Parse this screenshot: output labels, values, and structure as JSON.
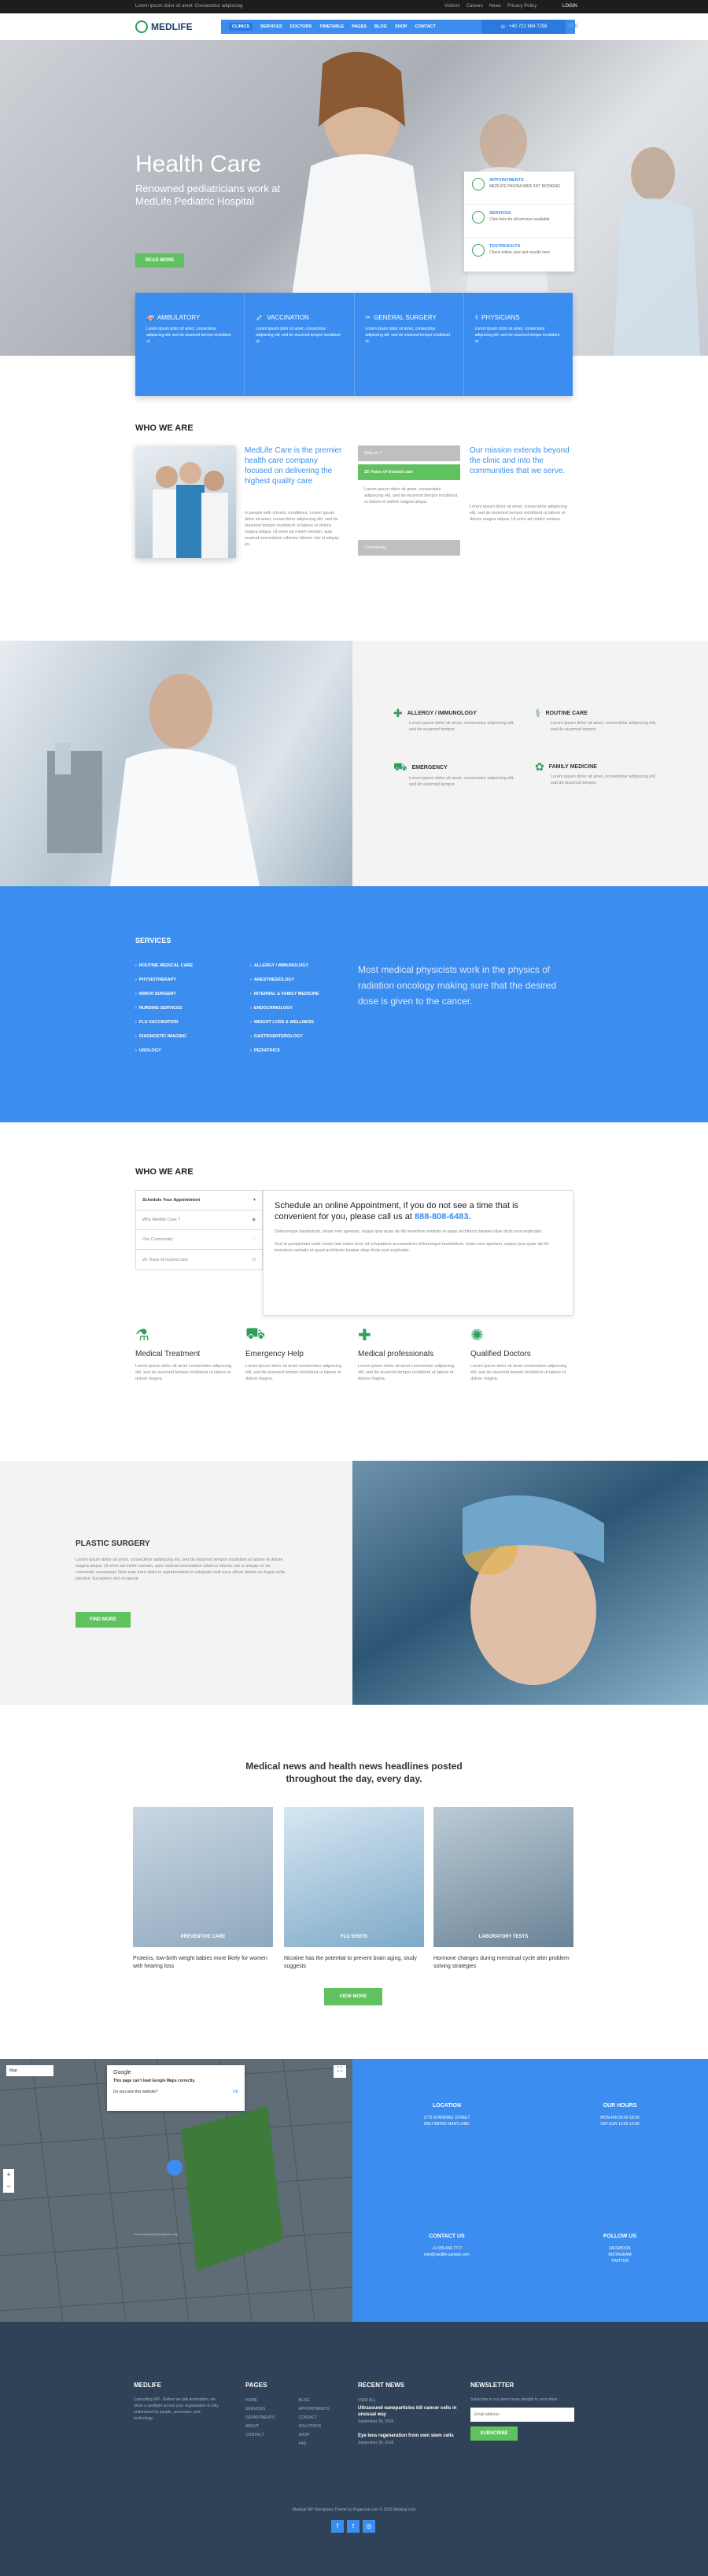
{
  "topbar": {
    "left": "Lorem ipsum dolor sit amet: Consectetur adipiscing",
    "links": [
      "Visitors",
      "Careers",
      "News",
      "Privacy Policy"
    ],
    "login": "LOGIN"
  },
  "header": {
    "logo": "MEDLIFE",
    "nav": [
      "CLINICS",
      "SERVICES",
      "DOCTORS",
      "TIMETABLE",
      "PAGES",
      "BLOG",
      "SHOP",
      "CONTACT"
    ],
    "phone": "+40 722 884 7256",
    "cart": "0"
  },
  "hero": {
    "title": "Health Care",
    "subtitle": "Renowned pediatricians work at MedLife Pediatric Hospital",
    "button": "READ MORE"
  },
  "side_card": [
    {
      "title": "APPOINTMENTS",
      "text": "MEDLIFE PAGINA WEB 24/7 BOOKING"
    },
    {
      "title": "SERVICES",
      "text": "Click here for all services available"
    },
    {
      "title": "TESTRESULTS",
      "text": "Check online your test results here"
    }
  ],
  "features": [
    {
      "title": "AMBULATORY",
      "text": "Lorem ipsum dolor sit amet, consectetur adipiscing elit, sed do eiusmod tempor incididunt ut."
    },
    {
      "title": "VACCINATION",
      "text": "Lorem ipsum dolor sit amet, consectetur adipiscing elit, sed do eiusmod tempor incididunt ut."
    },
    {
      "title": "GENERAL SURGERY",
      "text": "Lorem ipsum dolor sit amet, consectetur adipiscing elit, sed do eiusmod tempor incididunt ut."
    },
    {
      "title": "PHYSICIANS",
      "text": "Lorem ipsum dolor sit amet, consectetur adipiscing elit, sed do eiusmod tempor incididunt ut."
    }
  ],
  "who": {
    "heading": "WHO WE ARE",
    "lead": "MedLife Care is the premier health care company focused on delivering the highest quality care",
    "body": "In people with chronic conditions, Lorem ipsum dolor sit amet, consectetur adipiscing elit, sed do eiusmod tempor incididunt ut labore et dolore magna aliqua. Ut enim ad minim veniam, quis nostrud exercitation ullamco laboris nisi ut aliquip ex.",
    "tabs": [
      "Why us ?",
      "25 Years of trusted care",
      "Community"
    ],
    "tab_text": "Lorem ipsum dolor sit amet, consectetur adipiscing elit, sed do eiusmod tempor incididunt ut labore et dolore magna aliqua.",
    "mission": "Our mission extends beyond the clinic and into the communities that we serve.",
    "mission_text": "Lorem ipsum dolor sit amet, consectetur adipiscing elit, sed do eiusmod tempor incididunt ut labore et dolore magna aliqua. Ut enim ad minim veniam."
  },
  "lab": [
    {
      "title": "ALLERGY / IMMUNOLOGY",
      "text": "Lorem ipsum dolor sit amet, consectetur adipiscing elit, sed do eiusmod tempor."
    },
    {
      "title": "ROUTINE CARE",
      "text": "Lorem ipsum dolor sit amet, consectetur adipiscing elit, sed do eiusmod tempor."
    },
    {
      "title": "EMERGENCY",
      "text": "Lorem ipsum dolor sit amet, consectetur adipiscing elit, sed do eiusmod tempor."
    },
    {
      "title": "FAMILY MEDICINE",
      "text": "Lorem ipsum dolor sit amet, consectetur adipiscing elit, sed do eiusmod tempor."
    }
  ],
  "services": {
    "heading": "SERVICES",
    "col1": [
      "ROUTINE MEDICAL CARE",
      "PHYSIOTHERAPY",
      "MINOR SURGERY",
      "NURSING SERVICES",
      "FLU VACCINATION",
      "DIAGNOSTIC IMAGING",
      "UROLOGY"
    ],
    "col2": [
      "ALLERGY / IMMUNOLOGY",
      "ANESTHESIOLOGY",
      "INTERNAL & FAMILY MEDICINE",
      "ENDOCRINOLOGY",
      "WEIGHT LOSS & WELLNESS",
      "GASTROENTEROLOGY",
      "PEDIATRICS"
    ],
    "quote": "Most medical physicists work in the physics of radiation oncology making sure that the desired dose is given to the cancer."
  },
  "who2": {
    "heading": "WHO WE ARE",
    "accordion": [
      "Schedule Your Appointment",
      "Why Medlife Care ?",
      "Our Community",
      "25 Years of trusted care"
    ],
    "appt_title": "Schedule an online Appointment, if you do not see a time that is convenient for you, please call us at",
    "appt_phone": "888-808-6483.",
    "appt_text1": "Doloremque laudantium, totam rem aperiam, eaque ipsa quae ab illo inventore veritatis et quasi architecto beatae vitae dicta sunt explicabo.",
    "appt_text2": "Sed ut perspiciatis unde omnis iste natus error sit voluptatem accusantium doloremque laudantium, totam rem aperiam, eaque ipsa quae ab illo inventore veritatis et quasi architecto beatae vitae dicta sunt explicabo.",
    "items": [
      {
        "title": "Medical Treatment",
        "text": "Lorem ipsum dolor sit amet consectetur adipiscing elit, sed do eiusmod tempor incididunt ut labore et dolore magna."
      },
      {
        "title": "Emergency Help",
        "text": "Lorem ipsum dolor sit amet consectetur adipiscing elit, sed do eiusmod tempor incididunt ut labore et dolore magna."
      },
      {
        "title": "Medical professionals",
        "text": "Lorem ipsum dolor sit amet consectetur adipiscing elit, sed do eiusmod tempor incididunt ut labore et dolore magna."
      },
      {
        "title": "Qualified Doctors",
        "text": "Lorem ipsum dolor sit amet consectetur adipiscing elit, sed do eiusmod tempor incididunt ut labore et dolore magna."
      }
    ]
  },
  "plastic": {
    "heading": "PLASTIC SURGERY",
    "text": "Lorem ipsum dolor sit amet, consectetur adipiscing elit, sed do eiusmod tempor incididunt ut labore et dolore magna aliqua. Ut enim ad minim veniam, quis nostrud exercitation ullamco laboris nisi ut aliquip ex ea commodo consequat. Duis aute irure dolor in reprehenderit in voluptate velit esse cillum dolore eu fugiat nulla pariatur. Excepteur sint occaecat.",
    "button": "FIND MORE"
  },
  "news": {
    "heading": "Medical news and health news headlines posted throughout the day, every day.",
    "cards": [
      {
        "label": "PREVENTIVE CARE",
        "text": "Proteins, low-birth weight babies more likely for women with hearing loss"
      },
      {
        "label": "FLU SHOTS",
        "text": "Nicotine has the potential to prevent brain aging, study suggests"
      },
      {
        "label": "LABORATORY TESTS",
        "text": "Hormone changes during menstrual cycle alter problem-solving strategies"
      }
    ],
    "button": "VIEW MORE"
  },
  "map": {
    "dialog_title": "Google",
    "dialog_text": "This page can't load Google Maps correctly.",
    "dialog_q": "Do you own this website?",
    "dialog_ok": "OK",
    "search": "Map",
    "street_label": "For development purposes only"
  },
  "contact": {
    "location_h": "LOCATION",
    "location": [
      "1775 STANDING STREET",
      "BALTIMORE MARYLAND"
    ],
    "hours_h": "OUR HOURS",
    "hours": [
      "MON-FRI 09:00-18:00",
      "SAT-SUN 10:00-14:00"
    ],
    "contact_h": "CONTACT US",
    "contact": [
      "+1-555-666-7777",
      "info@medlife-sample.com"
    ],
    "follow_h": "FOLLOW US",
    "follow": [
      "FACEBOOK",
      "INSTAGRAM",
      "TWITTER"
    ]
  },
  "footer": {
    "about_h": "MEDLIFE",
    "about": "Consulting WP - Before we talk destination, we shine a spotlight across your organization to fully understand its people, processes, and technology.",
    "pages_h": "PAGES",
    "pages_c1": [
      "HOME",
      "SERVICES",
      "DEPARTMENTS",
      "ABOUT",
      "CONTACT"
    ],
    "pages_c2": [
      "BLOG",
      "APPOINTMENTS",
      "CONTACT SOLUTIONS",
      "SHOP",
      "FAQ"
    ],
    "news_h": "RECENT NEWS",
    "news_all": "VIEW ALL",
    "news1": "Ultrasound nanoparticles kill cancer cells in unusual way",
    "news1_date": "September 30, 2016",
    "news2": "Eye lens regeneration from own stem cells",
    "news2_date": "September 30, 2016",
    "nl_h": "NEWSLETTER",
    "nl_text": "Subscribe to our latest news straight to your inbox.",
    "nl_placeholder": "Email address",
    "nl_button": "SUBSCRIBE",
    "copyright": "Medical WP Wordpress Theme by Pagecore.com © 2016 Medical.com"
  }
}
